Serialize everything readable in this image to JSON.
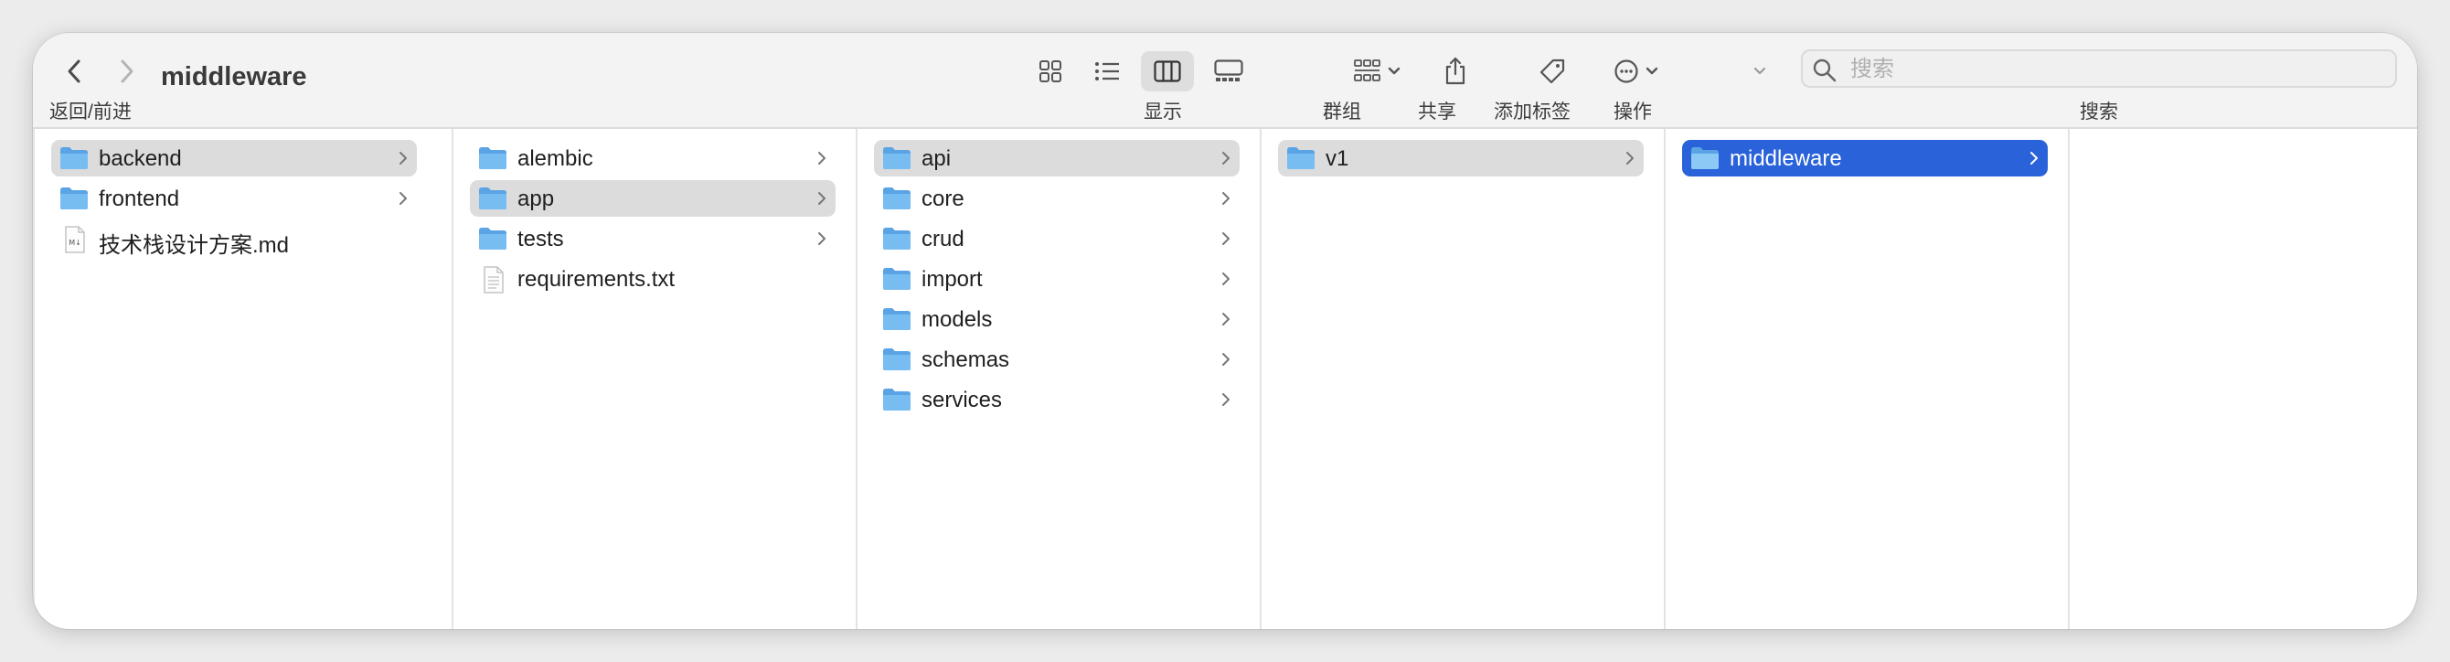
{
  "toolbar": {
    "title": "middleware",
    "nav_label": "返回/前进",
    "view_label": "显示",
    "group_label": "群组",
    "share_label": "共享",
    "tags_label": "添加标签",
    "action_label": "操作",
    "search_label": "搜索",
    "search_placeholder": "搜索"
  },
  "columns": [
    {
      "items": [
        {
          "name": "backend",
          "type": "folder"
        },
        {
          "name": "frontend",
          "type": "folder"
        },
        {
          "name": "技术栈设计方案.md",
          "type": "md"
        }
      ]
    },
    {
      "items": [
        {
          "name": "alembic",
          "type": "folder"
        },
        {
          "name": "app",
          "type": "folder"
        },
        {
          "name": "tests",
          "type": "folder"
        },
        {
          "name": "requirements.txt",
          "type": "txt"
        }
      ]
    },
    {
      "items": [
        {
          "name": "api",
          "type": "folder"
        },
        {
          "name": "core",
          "type": "folder"
        },
        {
          "name": "crud",
          "type": "folder"
        },
        {
          "name": "import",
          "type": "folder"
        },
        {
          "name": "models",
          "type": "folder"
        },
        {
          "name": "schemas",
          "type": "folder"
        },
        {
          "name": "services",
          "type": "folder"
        }
      ]
    },
    {
      "items": [
        {
          "name": "v1",
          "type": "folder"
        }
      ]
    },
    {
      "items": [
        {
          "name": "middleware",
          "type": "folder"
        }
      ]
    }
  ],
  "md_badge": "M↓",
  "colors": {
    "selection_active": "#2962d9",
    "selection_inactive": "#dcdcdc",
    "folder": "#6fb8ef"
  }
}
